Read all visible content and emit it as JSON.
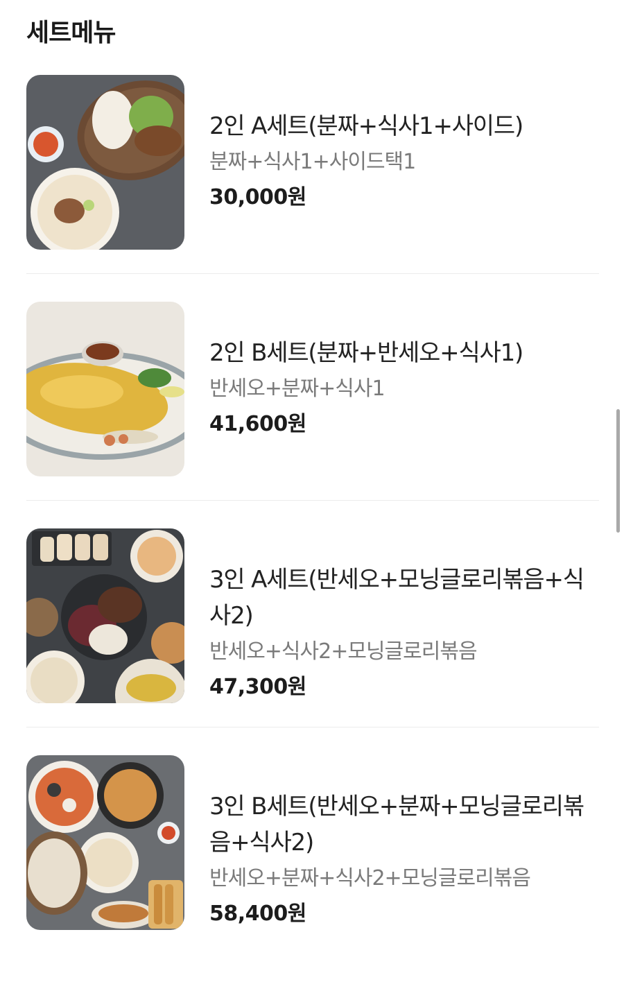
{
  "page": {
    "section_title": "세트메뉴"
  },
  "menu_items": [
    {
      "name": "2인 A세트(분짜+식사1+사이드)",
      "description": "분짜+식사1+사이드택1",
      "price": "30,000원"
    },
    {
      "name": "2인 B세트(분짜+반세오+식사1)",
      "description": "반세오+분짜+식사1",
      "price": "41,600원"
    },
    {
      "name": "3인 A세트(반세오+모닝글로리볶음+식사2)",
      "description": "반세오+식사2+모닝글로리볶음",
      "price": "47,300원"
    },
    {
      "name": "3인 B세트(반세오+분짜+모닝글로리볶음+식사2)",
      "description": "반세오+분짜+식사2+모닝글로리볶음",
      "price": "58,400원"
    }
  ]
}
